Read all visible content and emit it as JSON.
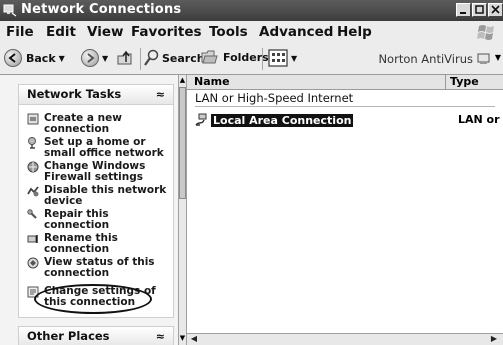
{
  "window": {
    "title": "Network Connections"
  },
  "menu": [
    "File",
    "Edit",
    "View",
    "Favorites",
    "Tools",
    "Advanced",
    "Help"
  ],
  "toolbar": {
    "back_label": "Back",
    "search_label": "Search",
    "folders_label": "Folders",
    "norton_label": "Norton AntiVirus"
  },
  "left_pane": {
    "network_tasks": {
      "title": "Network Tasks",
      "items": [
        {
          "label": "Create a new connection",
          "icon": "new-connection-icon"
        },
        {
          "label": "Set up a home or small office network",
          "icon": "home-network-icon"
        },
        {
          "label": "Change Windows Firewall settings",
          "icon": "firewall-icon"
        },
        {
          "label": "Disable this network device",
          "icon": "disable-device-icon"
        },
        {
          "label": "Repair this connection",
          "icon": "repair-icon"
        },
        {
          "label": "Rename this connection",
          "icon": "rename-icon"
        },
        {
          "label": "View status of this connection",
          "icon": "status-icon"
        },
        {
          "label": "Change settings of this connection",
          "icon": "settings-icon"
        }
      ]
    },
    "other_places": {
      "title": "Other Places"
    }
  },
  "content": {
    "columns": {
      "name": "Name",
      "type": "Type"
    },
    "group_header": "LAN or High-Speed Internet",
    "connection": {
      "name": "Local Area Connection",
      "type": "LAN or H"
    }
  }
}
